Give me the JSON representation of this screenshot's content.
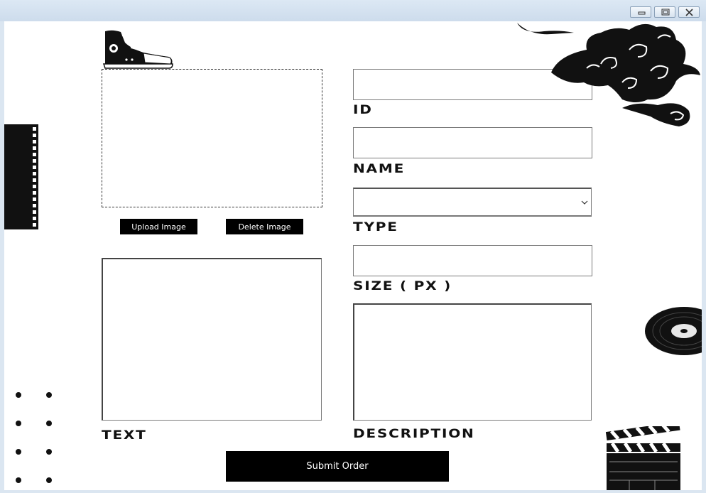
{
  "window": {
    "controls": [
      "minimize-icon",
      "maximize-icon",
      "close-icon"
    ]
  },
  "image_panel": {
    "upload_label": "Upload Image",
    "delete_label": "Delete Image"
  },
  "form": {
    "id_label": "ID",
    "name_label": "NAME",
    "type_label": "TYPE",
    "size_label": "SIZE ( PX )",
    "description_label": "DESCRIPTION",
    "text_label": "TEXT",
    "id_value": "",
    "name_value": "",
    "type_value": "",
    "size_value": "",
    "description_value": "",
    "text_value": ""
  },
  "submit_label": "Submit Order",
  "decorations": [
    "sneaker-icon",
    "film-strip-icon",
    "cloud-icon",
    "vinyl-record-icon",
    "clapperboard-icon",
    "dots-pattern"
  ],
  "colors": {
    "accent": "#000000",
    "background": "#ffffff",
    "titlebar": "#d6e2ef"
  }
}
